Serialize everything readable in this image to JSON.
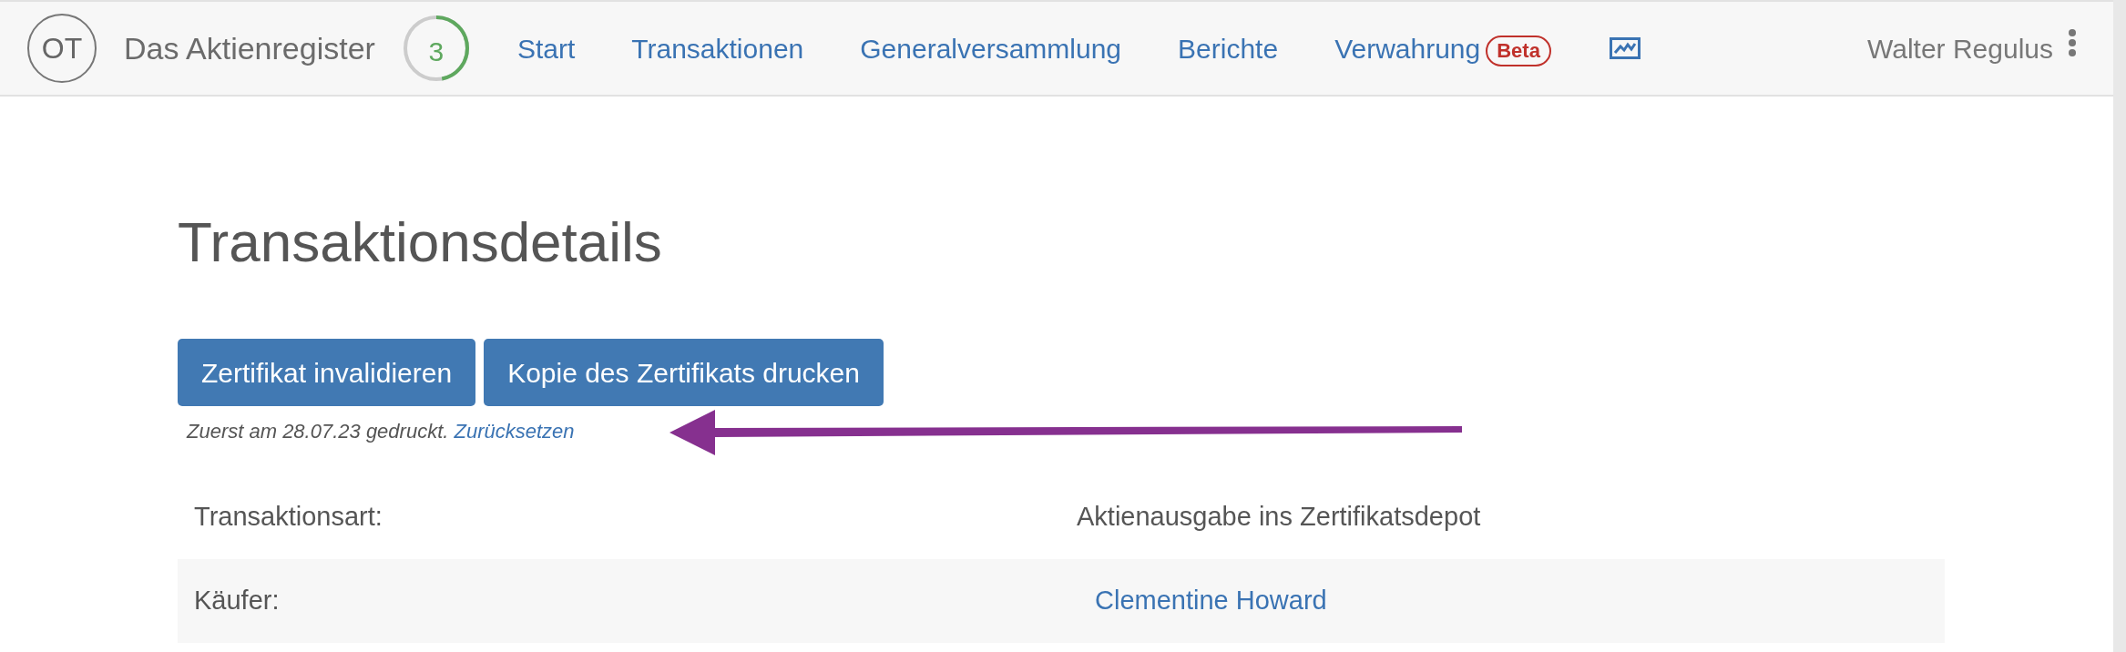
{
  "navbar": {
    "avatar": "OT",
    "title": "Das Aktienregister",
    "progress": {
      "count": "3",
      "level": 0.47
    },
    "links": [
      {
        "label": "Start"
      },
      {
        "label": "Transaktionen"
      },
      {
        "label": "Generalversammlung"
      },
      {
        "label": "Berichte"
      },
      {
        "label": "Verwahrung",
        "badge": "Beta"
      }
    ],
    "user": "Walter Regulus"
  },
  "page": {
    "heading": "Transaktionsdetails",
    "buttons": [
      "Zertifikat invalidieren",
      "Kopie des Zertifikats drucken"
    ],
    "note": {
      "text": "Zuerst am 28.07.23 gedruckt.",
      "link": "Zurücksetzen"
    },
    "rows": [
      {
        "label": "Transaktionsart:",
        "value": "Aktienausgabe ins Zertifikatsdepot",
        "kind": "text"
      },
      {
        "label": "Käufer:",
        "value": "Clementine Howard",
        "kind": "link"
      }
    ]
  }
}
